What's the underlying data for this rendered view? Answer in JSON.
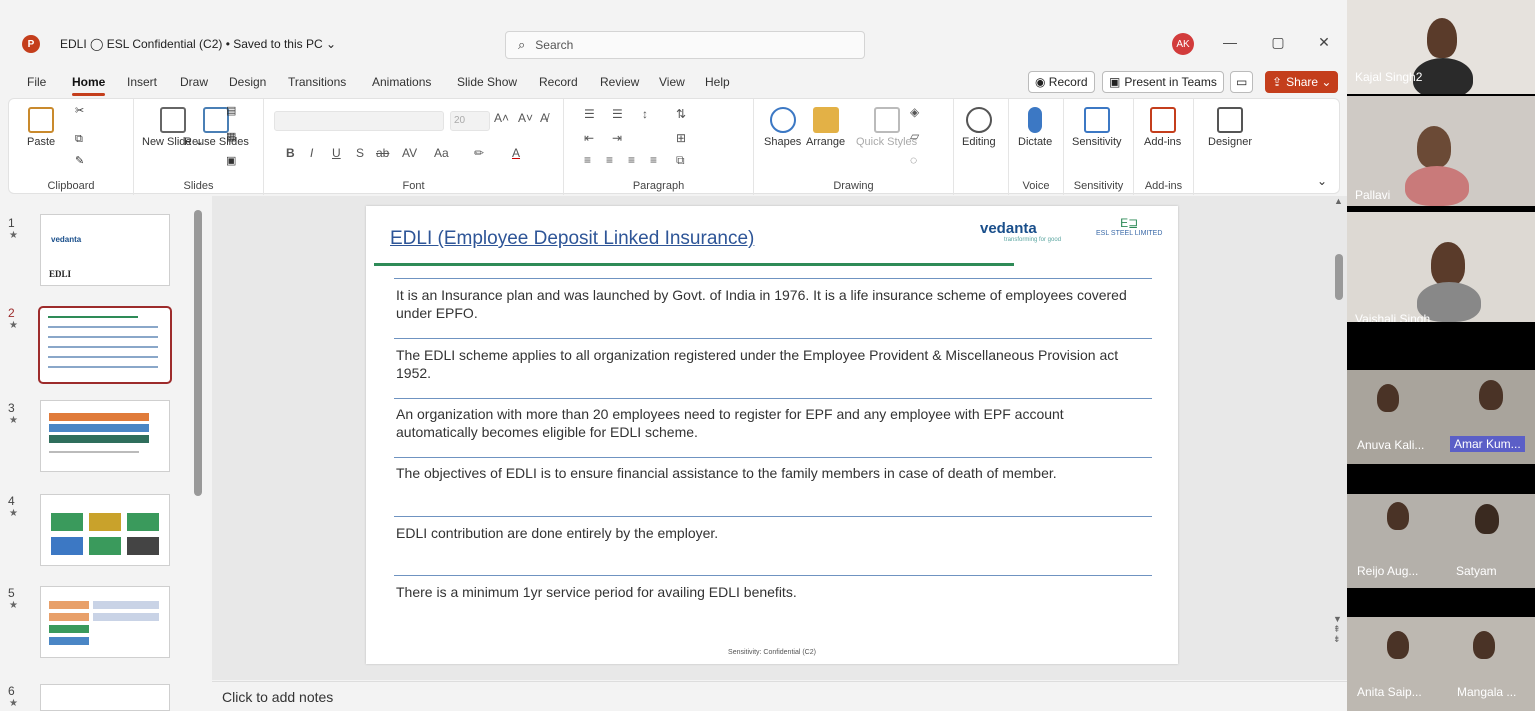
{
  "window": {
    "app_icon": "P",
    "doc_title": "EDLI  ◯ ESL Confidential (C2) • Saved to this PC ⌄",
    "search_placeholder": "Search",
    "user_initials": "AK"
  },
  "menu": {
    "tabs": [
      "File",
      "Home",
      "Insert",
      "Draw",
      "Design",
      "Transitions",
      "Animations",
      "Slide Show",
      "Record",
      "Review",
      "View",
      "Help"
    ],
    "active_tab": "Home",
    "record_btn": "◉ Record",
    "present_btn": "Present in Teams",
    "share_btn": "Share ⌄"
  },
  "ribbon": {
    "groups": {
      "clipboard": "Clipboard",
      "slides": "Slides",
      "font": "Font",
      "paragraph": "Paragraph",
      "drawing": "Drawing",
      "voice": "Voice",
      "sensitivity": "Sensitivity",
      "addins": "Add-ins"
    },
    "buttons": {
      "paste": "Paste",
      "new_slide": "New Slide ⌄",
      "reuse_slides": "Reuse Slides",
      "font_size": "20",
      "shapes": "Shapes",
      "arrange": "Arrange",
      "quick_styles": "Quick Styles",
      "editing": "Editing",
      "dictate": "Dictate",
      "sensitivity": "Sensitivity",
      "addins": "Add-ins",
      "designer": "Designer"
    }
  },
  "thumbnails": [
    {
      "num": "1",
      "title": "EDLI"
    },
    {
      "num": "2"
    },
    {
      "num": "3"
    },
    {
      "num": "4"
    },
    {
      "num": "5"
    },
    {
      "num": "6"
    }
  ],
  "selected_slide": 2,
  "slide": {
    "title": "EDLI (Employee Deposit Linked Insurance)",
    "logo_text": "vedanta",
    "logo_tagline": "transforming for good",
    "esl_logo": "ESL STEEL LIMITED",
    "bullets": [
      "It is an Insurance plan and was launched by Govt. of India in 1976. It is a life insurance scheme of employees covered under EPFO.",
      "The EDLI scheme applies to all organization registered under the Employee Provident & Miscellaneous Provision act 1952.",
      "An organization with more than 20 employees need to register for EPF and any employee with EPF account automatically becomes eligible for EDLI scheme.",
      "The objectives of EDLI is to ensure financial assistance to the family members in case of death of member.",
      "EDLI contribution are done entirely by the employer.",
      "There is a minimum  1yr service period for availing EDLI benefits."
    ],
    "footer": "Sensitivity: Confidential (C2)"
  },
  "notes_placeholder": "Click to add notes",
  "participants": [
    {
      "name": "Kajal Singh2"
    },
    {
      "name": "Pallavi"
    },
    {
      "name": "Vaishali Singh"
    },
    {
      "name": "Anuva Kali..."
    },
    {
      "name": "Amar Kum..."
    },
    {
      "name": "Reijo Aug..."
    },
    {
      "name": "Satyam"
    },
    {
      "name": "Anita Saip..."
    },
    {
      "name": "Mangala ..."
    }
  ],
  "colors": {
    "accent": "#c43e1c",
    "title_blue": "#2e5597",
    "rule_green": "#2e8b57"
  }
}
